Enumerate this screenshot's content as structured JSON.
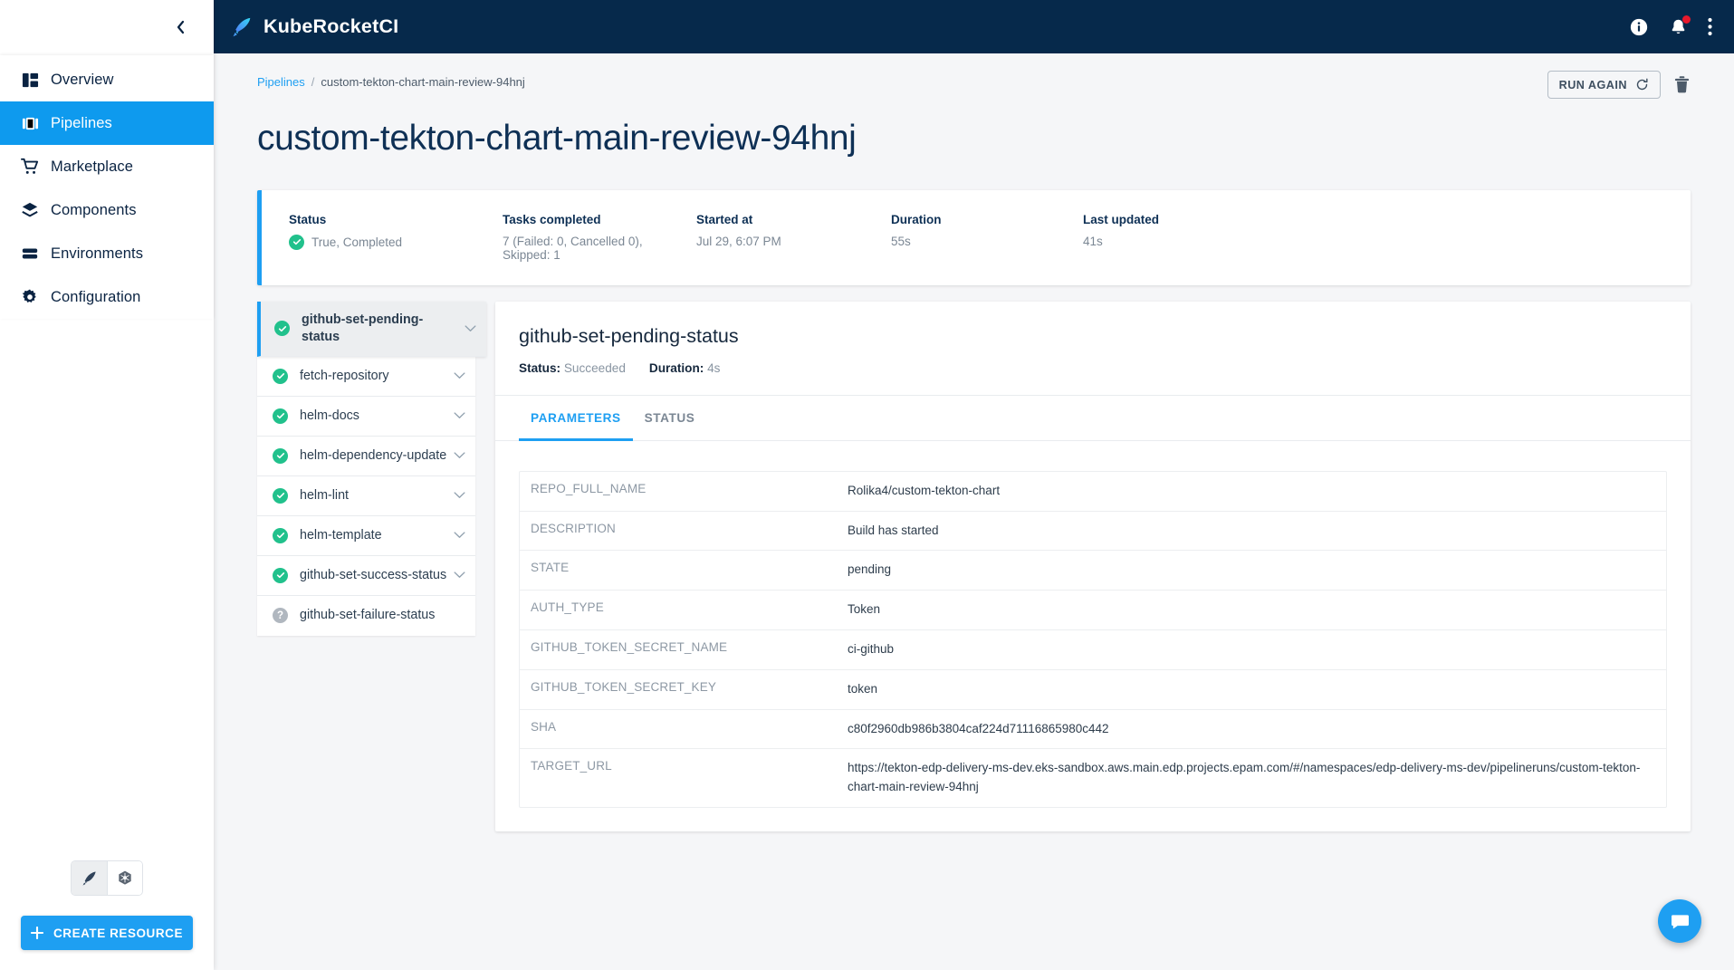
{
  "sidebar": {
    "collapse_icon": "chevron-left-icon",
    "items": [
      {
        "label": "Overview",
        "icon": "dashboard-icon",
        "active": false
      },
      {
        "label": "Pipelines",
        "icon": "pipelines-icon",
        "active": true
      },
      {
        "label": "Marketplace",
        "icon": "cart-icon",
        "active": false
      },
      {
        "label": "Components",
        "icon": "layers-icon",
        "active": false
      },
      {
        "label": "Environments",
        "icon": "environments-icon",
        "active": false
      },
      {
        "label": "Configuration",
        "icon": "gear-icon",
        "active": false
      }
    ],
    "mode_toggle": [
      {
        "icon": "kuberocket-feather-icon",
        "selected": true
      },
      {
        "icon": "kubernetes-helm-icon",
        "selected": false
      }
    ],
    "create_resource_label": "CREATE RESOURCE"
  },
  "topbar": {
    "brand": "KubeRocketCI",
    "logo_icon": "kuberocket-feather-icon",
    "actions": [
      {
        "icon": "info-icon",
        "badge": false
      },
      {
        "icon": "bell-icon",
        "badge": true
      },
      {
        "icon": "more-vertical-icon",
        "badge": false
      }
    ]
  },
  "breadcrumb": {
    "root": "Pipelines",
    "separator": "/",
    "current": "custom-tekton-chart-main-review-94hnj"
  },
  "header": {
    "title": "custom-tekton-chart-main-review-94hnj",
    "run_again_label": "RUN AGAIN",
    "run_again_icon": "refresh-icon",
    "delete_icon": "trash-icon"
  },
  "status_card": {
    "accent_color": "#1e9ff2",
    "stats": [
      {
        "label": "Status",
        "value": "True, Completed",
        "icon": "check-circle-icon"
      },
      {
        "label": "Tasks completed",
        "value": "7 (Failed: 0, Cancelled 0), Skipped: 1",
        "icon": ""
      },
      {
        "label": "Started at",
        "value": "Jul 29, 6:07 PM",
        "icon": ""
      },
      {
        "label": "Duration",
        "value": "55s",
        "icon": ""
      },
      {
        "label": "Last updated",
        "value": "41s",
        "icon": ""
      }
    ]
  },
  "tasks": [
    {
      "name": "github-set-pending-status",
      "status": "succeeded",
      "icon": "check-circle-icon",
      "selected": true,
      "chevron": "chevron-down-icon"
    },
    {
      "name": "fetch-repository",
      "status": "succeeded",
      "icon": "check-circle-icon",
      "selected": false,
      "chevron": "chevron-down-icon"
    },
    {
      "name": "helm-docs",
      "status": "succeeded",
      "icon": "check-circle-icon",
      "selected": false,
      "chevron": "chevron-down-icon"
    },
    {
      "name": "helm-dependency-update",
      "status": "succeeded",
      "icon": "check-circle-icon",
      "selected": false,
      "chevron": "chevron-down-icon"
    },
    {
      "name": "helm-lint",
      "status": "succeeded",
      "icon": "check-circle-icon",
      "selected": false,
      "chevron": "chevron-down-icon"
    },
    {
      "name": "helm-template",
      "status": "succeeded",
      "icon": "check-circle-icon",
      "selected": false,
      "chevron": "chevron-down-icon"
    },
    {
      "name": "github-set-success-status",
      "status": "succeeded",
      "icon": "check-circle-icon",
      "selected": false,
      "chevron": "chevron-down-icon"
    },
    {
      "name": "github-set-failure-status",
      "status": "skipped",
      "icon": "question-circle-icon",
      "selected": false,
      "chevron": ""
    }
  ],
  "detail": {
    "title": "github-set-pending-status",
    "status_key": "Status:",
    "status_value": "Succeeded",
    "duration_key": "Duration:",
    "duration_value": "4s",
    "tabs": [
      {
        "label": "PARAMETERS",
        "active": true
      },
      {
        "label": "STATUS",
        "active": false
      }
    ],
    "parameters": [
      {
        "key": "REPO_FULL_NAME",
        "value": "Rolika4/custom-tekton-chart"
      },
      {
        "key": "DESCRIPTION",
        "value": "Build has started"
      },
      {
        "key": "STATE",
        "value": "pending"
      },
      {
        "key": "AUTH_TYPE",
        "value": "Token"
      },
      {
        "key": "GITHUB_TOKEN_SECRET_NAME",
        "value": "ci-github"
      },
      {
        "key": "GITHUB_TOKEN_SECRET_KEY",
        "value": "token"
      },
      {
        "key": "SHA",
        "value": "c80f2960db986b3804caf224d71116865980c442"
      },
      {
        "key": "TARGET_URL",
        "value": "https://tekton-edp-delivery-ms-dev.eks-sandbox.aws.main.edp.projects.epam.com/#/namespaces/edp-delivery-ms-dev/pipelineruns/custom-tekton-chart-main-review-94hnj"
      }
    ]
  },
  "fab": {
    "icon": "chat-icon"
  }
}
